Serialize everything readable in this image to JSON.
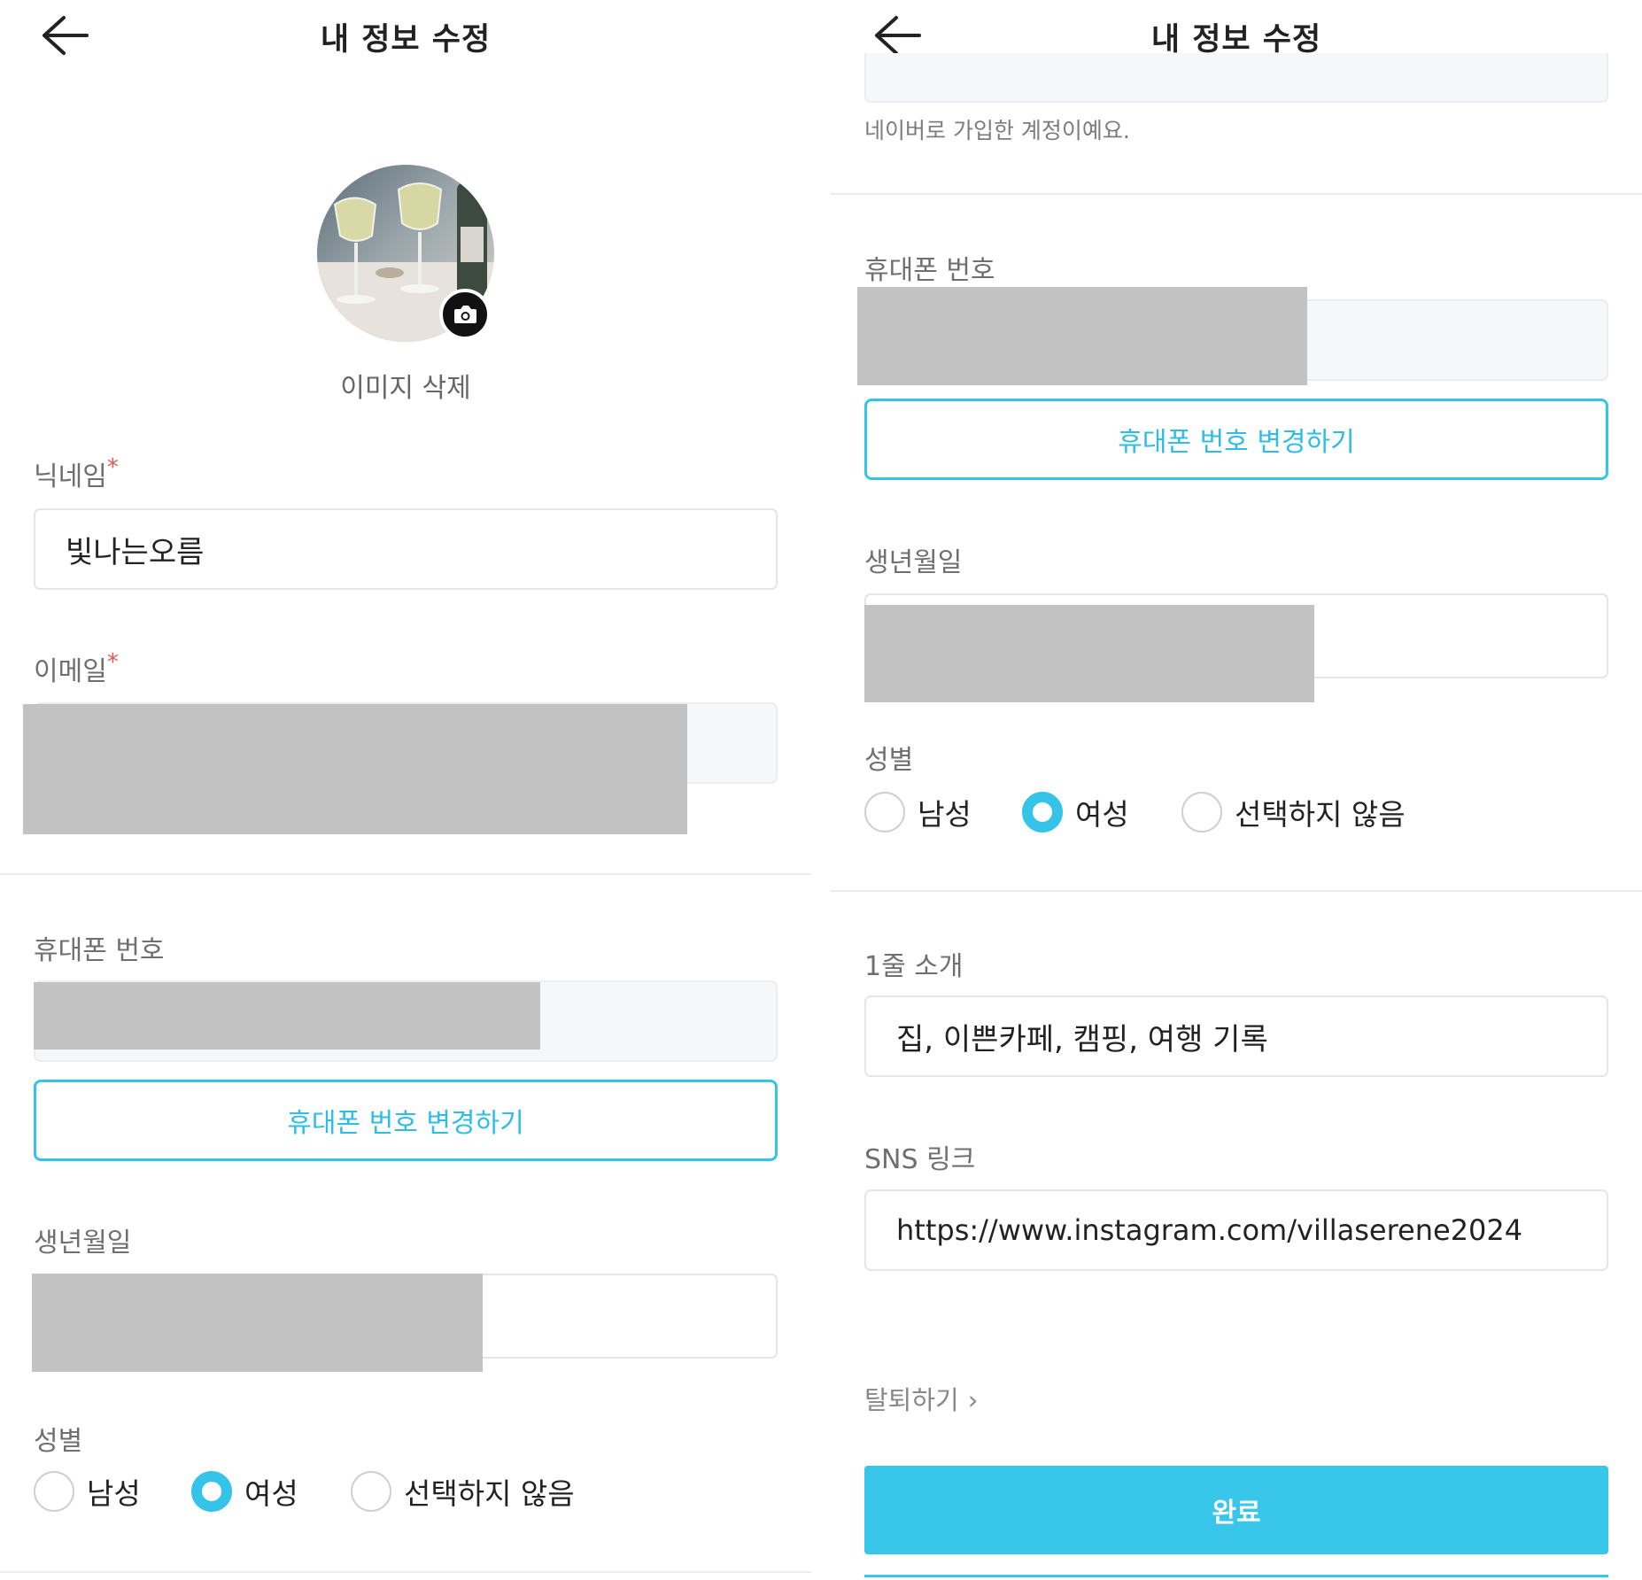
{
  "header": {
    "title": "내 정보 수정"
  },
  "profile": {
    "delete_image_label": "이미지 삭제"
  },
  "nickname": {
    "label": "닉네임",
    "required_mark": "*",
    "value": "빛나는오름"
  },
  "email": {
    "label": "이메일",
    "required_mark": "*",
    "helper": "네이버로 가입한 계정이예요."
  },
  "phone": {
    "label": "휴대폰 번호",
    "change_button": "휴대폰 번호 변경하기"
  },
  "birthdate": {
    "label": "생년월일"
  },
  "gender": {
    "label": "성별",
    "options": [
      "남성",
      "여성",
      "선택하지 않음"
    ],
    "selected": "여성"
  },
  "bio": {
    "label": "1줄 소개",
    "value": "집, 이쁜카페, 캠핑, 여행 기록"
  },
  "sns": {
    "label": "SNS 링크",
    "value": "https://www.instagram.com/villaserene2024"
  },
  "withdraw": {
    "label": "탈퇴하기",
    "chevron": "›"
  },
  "submit": {
    "label": "완료"
  },
  "colors": {
    "accent": "#35c4e7",
    "required": "#e4574f",
    "redaction": "#c2c2c2",
    "divider": "#ececec"
  },
  "icons": [
    "back-arrow-icon",
    "camera-icon",
    "chevron-right-icon"
  ]
}
